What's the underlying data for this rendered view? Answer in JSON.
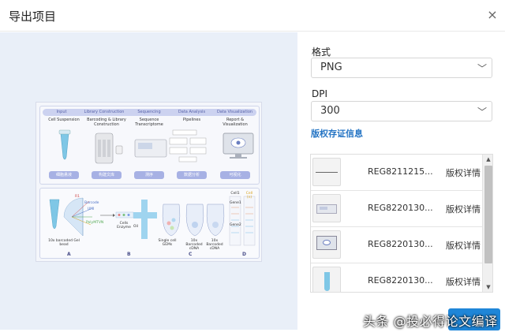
{
  "dialog": {
    "title": "导出项目",
    "close_label": "×"
  },
  "form": {
    "format_label": "格式",
    "format_value": "PNG",
    "dpi_label": "DPI",
    "dpi_value": "300",
    "copyright_link": "版权存证信息"
  },
  "copyright_list": {
    "rows": [
      {
        "id": "REG8211215...",
        "action": "版权详情"
      },
      {
        "id": "REG8220130...",
        "action": "版权详情"
      },
      {
        "id": "REG8220130...",
        "action": "版权详情"
      },
      {
        "id": "REG8220130...",
        "action": "版权详情"
      }
    ]
  },
  "watermark": "头条 @投必得论文编译",
  "figure": {
    "stages": [
      "Input",
      "Library Construction",
      "Sequencing",
      "Data Analysis",
      "Data Visualization"
    ],
    "columns": [
      {
        "title": "Cell Suspension",
        "button": "细胞悬液"
      },
      {
        "title": "Barcoding & Library Construction",
        "button": "构建文库"
      },
      {
        "title": "Sequence Transcriptome",
        "button": "测序"
      },
      {
        "title": "Pipelines",
        "button": "数据分析"
      },
      {
        "title": "Report & Visualization",
        "button": "可视化"
      }
    ],
    "bottom_labels": {
      "r1": "R1",
      "barcode": "Barcode",
      "umi": "UMI",
      "polyt": "PolyMTVN",
      "bead": "10x barcoded Gel bead",
      "cells": "Cells Enzyme",
      "oil": "Oil",
      "gems": "Single cell GEMs",
      "cdna1": "10x Barcoded cDNA",
      "cdna2": "10x Barcoded cDNA",
      "cell1": "Cell1",
      "cell_n": "Cell (n)",
      "gene1": "Gene1",
      "gene2": "Gene2"
    },
    "letters": [
      "A",
      "B",
      "C",
      "D"
    ],
    "colors": {
      "stage_bar": "#ccd2f0",
      "button": "#a7b1e4",
      "tube": "#7fc7e6"
    }
  }
}
